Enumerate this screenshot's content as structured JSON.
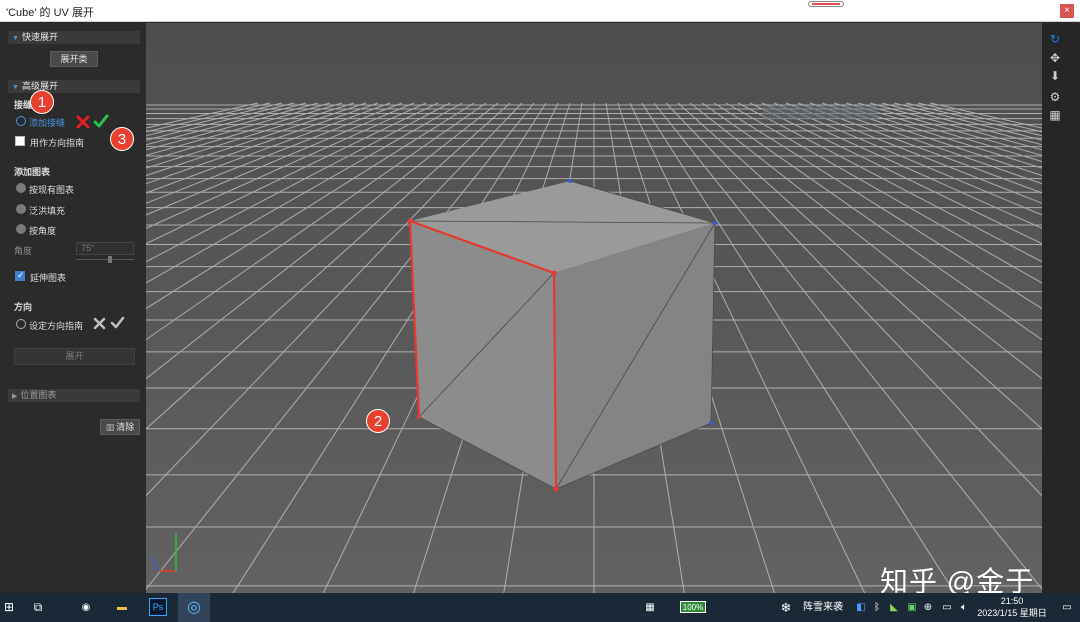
{
  "window": {
    "title": "'Cube' 的 UV 展开",
    "close_glyph": "×"
  },
  "left_panel": {
    "quick_unwrap": {
      "header": "快速展开",
      "unfold_button": "展开类"
    },
    "advanced_unwrap": {
      "header": "高级展开",
      "seams_label": "接缝",
      "add_seam_label": "添加接缝",
      "use_as_direction_label": "用作方向指南",
      "use_as_direction_checked": false,
      "add_chart_label": "添加图表",
      "by_existing_chart": "按现有图表",
      "flood_fill": "泛洪填充",
      "by_angle": "按角度",
      "angle_label": "角度",
      "angle_value": "75°",
      "stretch_chart_label": "延伸图表",
      "stretch_chart_checked": true,
      "direction_label": "方向",
      "set_direction_guide": "设定方向指南",
      "unfold_button": "展开"
    },
    "position_chart": {
      "header": "位置图表"
    },
    "clear_button": "清除"
  },
  "annotations": {
    "badge1": "1",
    "badge2": "2",
    "badge3": "3"
  },
  "right_toolbar": {
    "icons": [
      "refresh-icon",
      "fit-view-icon",
      "download-icon",
      "settings-icon",
      "grid-icon"
    ],
    "refresh_color": "#2b7de9"
  },
  "watermark": "知乎 @金于",
  "taskbar": {
    "ps_label": "Ps",
    "battery": "100%",
    "weather": "阵雪来袭",
    "time": "21:50",
    "date": "2023/1/15 星期日"
  },
  "colors": {
    "seam_red": "#e63a2e",
    "accent_blue": "#3d7fd1",
    "check_green": "#27c24c",
    "cross_red": "#e02020"
  }
}
